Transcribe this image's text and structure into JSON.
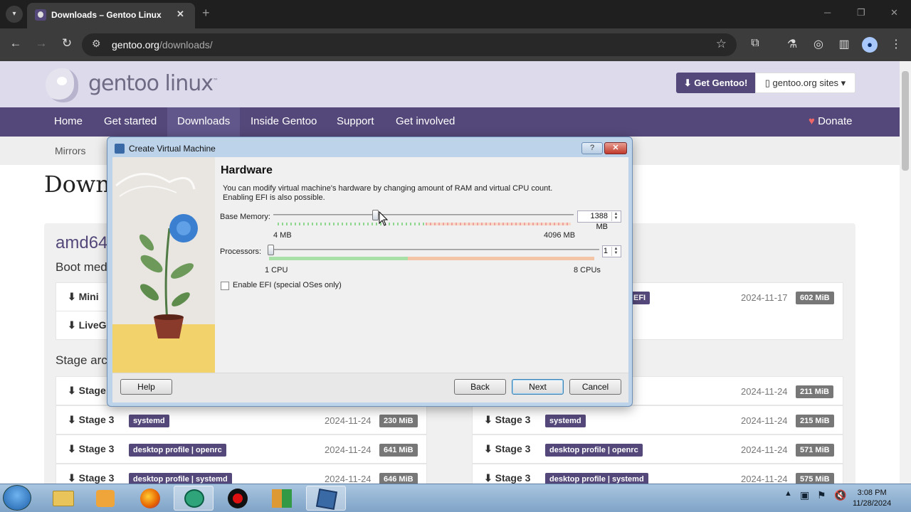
{
  "browser": {
    "tab_title": "Downloads – Gentoo Linux",
    "url_host": "gentoo.org",
    "url_path": "/downloads/"
  },
  "site": {
    "logo_text": "gentoo linux",
    "logo_tm": "™",
    "get_gentoo": "⬇ Get Gentoo!",
    "sites_menu": "▯ gentoo.org sites ▾",
    "nav": [
      "Home",
      "Get started",
      "Downloads",
      "Inside Gentoo",
      "Support",
      "Get involved"
    ],
    "active_nav": "Downloads",
    "donate": "Donate",
    "subnav": "Mirrors",
    "page_title_fragment": "Downl",
    "arch_fragment": "amd64",
    "boot_fragment": "Boot med",
    "stage_fragment": "Stage arc",
    "rows_left": [
      {
        "name": "Mini",
        "badge": "",
        "date": "",
        "size": ""
      },
      {
        "name": "LiveG",
        "badge": "",
        "date": "",
        "size": ""
      },
      {
        "name": "Stage",
        "badge": "",
        "date": "",
        "size": ""
      },
      {
        "name": "Stage 3",
        "badge": "systemd",
        "date": "2024-11-24",
        "size": "230 MiB"
      },
      {
        "name": "Stage 3",
        "badge": "desktop profile | openrc",
        "date": "2024-11-24",
        "size": "641 MiB"
      },
      {
        "name": "Stage 3",
        "badge": "desktop profile | systemd",
        "date": "2024-11-24",
        "size": "646 MiB"
      }
    ],
    "rows_right": [
      {
        "name": "",
        "badge": "EFI",
        "date": "2024-11-17",
        "size": "602 MiB"
      },
      {
        "name": "",
        "badge": "",
        "date": "2024-11-24",
        "size": "211 MiB"
      },
      {
        "name": "Stage 3",
        "badge": "systemd",
        "date": "2024-11-24",
        "size": "215 MiB"
      },
      {
        "name": "Stage 3",
        "badge": "desktop profile | openrc",
        "date": "2024-11-24",
        "size": "571 MiB"
      },
      {
        "name": "Stage 3",
        "badge": "desktop profile | systemd",
        "date": "2024-11-24",
        "size": "575 MiB"
      }
    ]
  },
  "dialog": {
    "title": "Create Virtual Machine",
    "help_glyph": "?",
    "close_glyph": "✕",
    "heading": "Hardware",
    "description": "You can modify virtual machine's hardware by changing amount of RAM and virtual CPU count. Enabling EFI is also possible.",
    "memory_label": "Base Memory:",
    "memory_value": "1388 MB",
    "memory_min": "4 MB",
    "memory_max": "4096 MB",
    "memory_fraction": 0.338,
    "cpu_label": "Processors:",
    "cpu_value": "1",
    "cpu_min": "1 CPU",
    "cpu_max": "8 CPUs",
    "cpu_fraction": 0,
    "efi_label": "Enable EFI (special OSes only)",
    "efi_checked": false,
    "buttons": {
      "help": "Help",
      "back": "Back",
      "next": "Next",
      "cancel": "Cancel"
    }
  },
  "taskbar": {
    "time": "3:08 PM",
    "date": "11/28/2024"
  },
  "colors": {
    "gentoo_purple": "#54487a",
    "header_bg": "#dddaec",
    "win_frame": "#bcd3ea"
  }
}
